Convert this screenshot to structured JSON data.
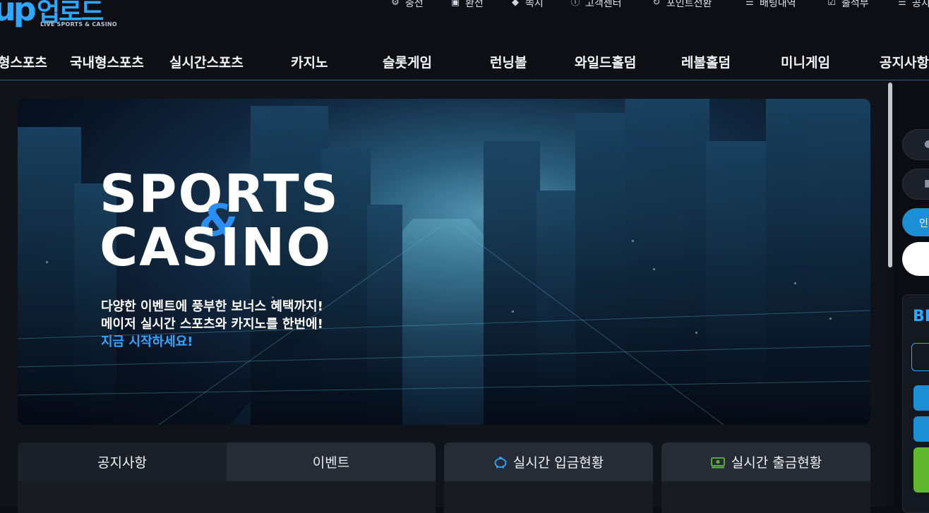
{
  "logo": {
    "mark": "up",
    "name": "업로드",
    "tagline": "LIVE SPORTS & CASINO"
  },
  "util_nav": [
    {
      "icon": "gear-icon",
      "glyph": "⚙",
      "label": "충전"
    },
    {
      "icon": "wallet-icon",
      "glyph": "▣",
      "label": "환전"
    },
    {
      "icon": "bell-icon",
      "glyph": "◆",
      "label": "쪽지"
    },
    {
      "icon": "info-icon",
      "glyph": "ⓘ",
      "label": "고객센터"
    },
    {
      "icon": "refresh-icon",
      "glyph": "↻",
      "label": "포인트전환"
    },
    {
      "icon": "list-icon",
      "glyph": "☰",
      "label": "배팅내역"
    },
    {
      "icon": "check-icon",
      "glyph": "☑",
      "label": "출석부"
    },
    {
      "icon": "list-icon",
      "glyph": "☰",
      "label": "공지"
    }
  ],
  "main_nav": [
    "해외형스포츠",
    "국내형스포츠",
    "실시간스포츠",
    "카지노",
    "슬롯게임",
    "런닝볼",
    "와일드홀덤",
    "레볼홀덤",
    "미니게임",
    "공지사항"
  ],
  "banner": {
    "title_1": "SPORTS",
    "amp": "&",
    "title_2": "CASINO",
    "line_1": "다양한 이벤트에 풍부한 보너스 혜택까지!",
    "line_2": "메이저 실시간 스포츠와 카지노를 한번에!",
    "line_3": "지금 시작하세요!"
  },
  "tabs": {
    "notice": "공지사항",
    "event": "이벤트"
  },
  "panels": {
    "deposit": {
      "icon": "piggybank-icon",
      "label": "실시간 입금현황"
    },
    "withdraw": {
      "icon": "cash-icon",
      "label": "실시간 출금현황"
    }
  },
  "sidebar": {
    "login": "인",
    "box_title": "BE"
  },
  "colors": {
    "accent": "#2ea7ff",
    "green": "#5fb82e",
    "nav_border": "#2d5fa0"
  }
}
